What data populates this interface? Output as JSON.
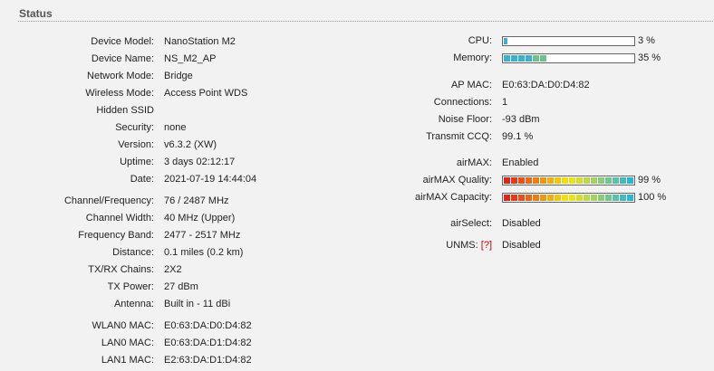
{
  "header": {
    "title": "Status"
  },
  "left": [
    {
      "label": "Device Model:",
      "value": "NanoStation M2"
    },
    {
      "label": "Device Name:",
      "value": "NS_M2_AP"
    },
    {
      "label": "Network Mode:",
      "value": "Bridge"
    },
    {
      "label": "Wireless Mode:",
      "value": "Access Point WDS"
    },
    {
      "label": "Hidden SSID",
      "value": ""
    },
    {
      "label": "Security:",
      "value": "none"
    },
    {
      "label": "Version:",
      "value": "v6.3.2 (XW)"
    },
    {
      "label": "Uptime:",
      "value": "3 days 02:12:17"
    },
    {
      "label": "Date:",
      "value": "2021-07-19 14:44:04"
    },
    {
      "label": "Channel/Frequency:",
      "value": "76 / 2487 MHz"
    },
    {
      "label": "Channel Width:",
      "value": "40 MHz (Upper)"
    },
    {
      "label": "Frequency Band:",
      "value": "2477 - 2517 MHz"
    },
    {
      "label": "Distance:",
      "value": "0.1 miles (0.2 km)"
    },
    {
      "label": "TX/RX Chains:",
      "value": "2X2"
    },
    {
      "label": "TX Power:",
      "value": "27 dBm"
    },
    {
      "label": "Antenna:",
      "value": "Built in - 11 dBi"
    },
    {
      "label": "WLAN0 MAC:",
      "value": "E0:63:DA:D0:D4:82"
    },
    {
      "label": "LAN0 MAC:",
      "value": "E0:63:DA:D1:D4:82"
    },
    {
      "label": "LAN1 MAC:",
      "value": "E2:63:DA:D1:D4:82"
    }
  ],
  "right": {
    "cpu": {
      "label": "CPU:",
      "percent": 3,
      "text": "3 %"
    },
    "memory": {
      "label": "Memory:",
      "percent": 35,
      "text": "35 %"
    },
    "ap_mac": {
      "label": "AP MAC:",
      "value": "E0:63:DA:D0:D4:82"
    },
    "connections": {
      "label": "Connections:",
      "value": "1"
    },
    "noise_floor": {
      "label": "Noise Floor:",
      "value": "-93 dBm"
    },
    "transmit_ccq": {
      "label": "Transmit CCQ:",
      "value": "99.1 %"
    },
    "airmax": {
      "label": "airMAX:",
      "value": "Enabled"
    },
    "airmax_quality": {
      "label": "airMAX Quality:",
      "percent": 99,
      "text": "99 %"
    },
    "airmax_capacity": {
      "label": "airMAX Capacity:",
      "percent": 100,
      "text": "100 %"
    },
    "airselect": {
      "label": "airSelect:",
      "value": "Disabled"
    },
    "unms": {
      "label": "UNMS:",
      "help": "[?]",
      "value": "Disabled"
    }
  },
  "colors": {
    "usage_bar": "#3bb0cf",
    "gradient_start": "#e0231b",
    "gradient_mid": "#f5e614",
    "gradient_end": "#2bb5d4"
  }
}
